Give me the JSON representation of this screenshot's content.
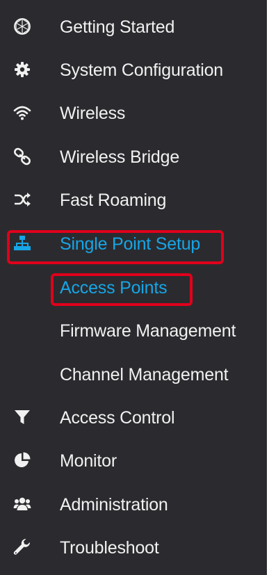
{
  "sidebar": {
    "items": [
      {
        "label": "Getting Started",
        "icon": "globe-icon"
      },
      {
        "label": "System Configuration",
        "icon": "gear-icon"
      },
      {
        "label": "Wireless",
        "icon": "wifi-icon"
      },
      {
        "label": "Wireless Bridge",
        "icon": "bridge-link-icon"
      },
      {
        "label": "Fast Roaming",
        "icon": "shuffle-icon"
      },
      {
        "label": "Single Point Setup",
        "icon": "sitemap-icon"
      },
      {
        "label": "Access Points",
        "icon": ""
      },
      {
        "label": "Firmware Management",
        "icon": ""
      },
      {
        "label": "Channel Management",
        "icon": ""
      },
      {
        "label": "Access Control",
        "icon": "filter-icon"
      },
      {
        "label": "Monitor",
        "icon": "pie-chart-icon"
      },
      {
        "label": "Administration",
        "icon": "users-icon"
      },
      {
        "label": "Troubleshoot",
        "icon": "wrench-icon"
      }
    ],
    "active_parent": "Single Point Setup",
    "active_child": "Access Points"
  },
  "colors": {
    "background": "#2b2b2f",
    "text": "#f1f1f1",
    "active": "#16a6e6",
    "highlight": "#e0001b"
  }
}
